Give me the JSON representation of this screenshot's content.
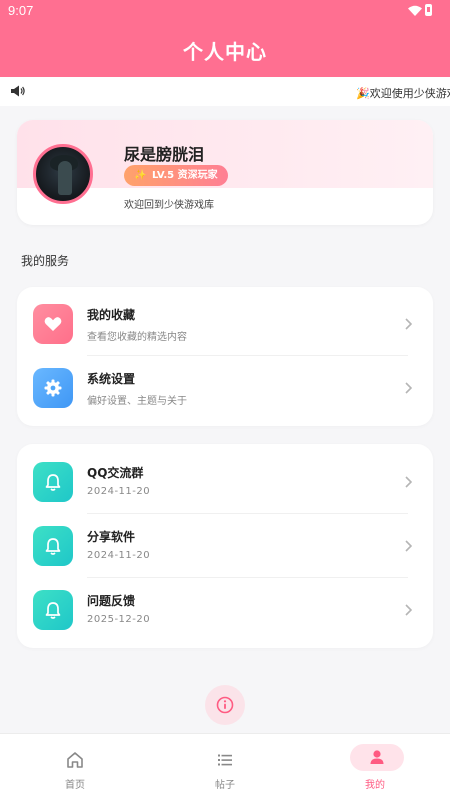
{
  "status_bar": {
    "time": "9:07"
  },
  "app_bar": {
    "title": "个人中心"
  },
  "notice": {
    "text": "🎉欢迎使用少侠游戏"
  },
  "profile": {
    "username": "尿是膀胱泪",
    "level": "LV.5",
    "rank": "资深玩家",
    "welcome": "欢迎回到少侠游戏库"
  },
  "services": {
    "title": "我的服务",
    "items": [
      {
        "label": "我的收藏",
        "sub": "查看您收藏的精选内容",
        "icon": "heart-icon"
      },
      {
        "label": "系统设置",
        "sub": "偏好设置、主题与关于",
        "icon": "gear-icon"
      }
    ]
  },
  "links": {
    "items": [
      {
        "label": "QQ交流群",
        "date": "2024-11-20",
        "icon": "bell-icon"
      },
      {
        "label": "分享软件",
        "date": "2024-11-20",
        "icon": "bell-icon"
      },
      {
        "label": "问题反馈",
        "date": "2025-12-20",
        "icon": "bell-icon"
      }
    ]
  },
  "bottom_nav": {
    "items": [
      {
        "label": "首页",
        "icon": "home-icon",
        "active": false
      },
      {
        "label": "帖子",
        "icon": "list-icon",
        "active": false
      },
      {
        "label": "我的",
        "icon": "user-icon",
        "active": true
      }
    ]
  },
  "colors": {
    "brand": "#ff6f91",
    "active_nav": "#ff5b82",
    "favorite_icon_bg": "#ff7f94",
    "settings_icon_bg": "#4fa6f8",
    "bell_icon_bg": "#2cd3c8"
  }
}
